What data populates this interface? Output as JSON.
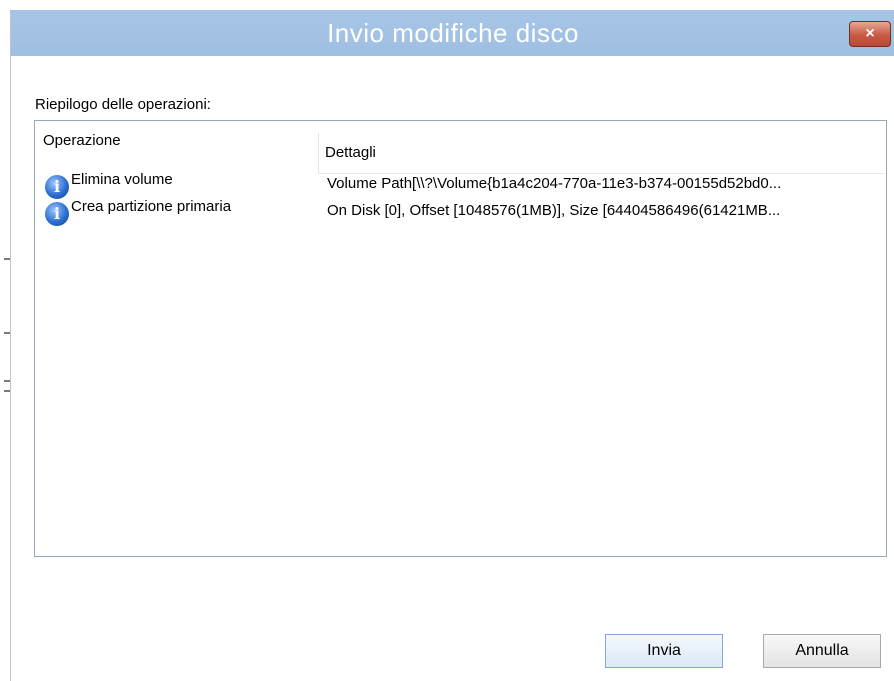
{
  "window": {
    "title": "Invio modifiche disco",
    "close_label": "×"
  },
  "summary": {
    "label": "Riepilogo delle operazioni:"
  },
  "table": {
    "headers": {
      "operation": "Operazione",
      "details": "Dettagli"
    },
    "rows": [
      {
        "icon": "info-icon",
        "operation": "Elimina volume",
        "details": "Volume Path[\\\\?\\Volume{b1a4c204-770a-11e3-b374-00155d52bd0..."
      },
      {
        "icon": "info-icon",
        "operation": "Crea partizione primaria",
        "details": "On Disk [0], Offset [1048576(1MB)], Size [64404586496(61421MB..."
      }
    ]
  },
  "buttons": {
    "send": "Invia",
    "cancel": "Annulla"
  },
  "colors": {
    "titlebar": "#a7c5e6",
    "close_button": "#c75a45",
    "primary_button_border": "#7fa8d6"
  }
}
